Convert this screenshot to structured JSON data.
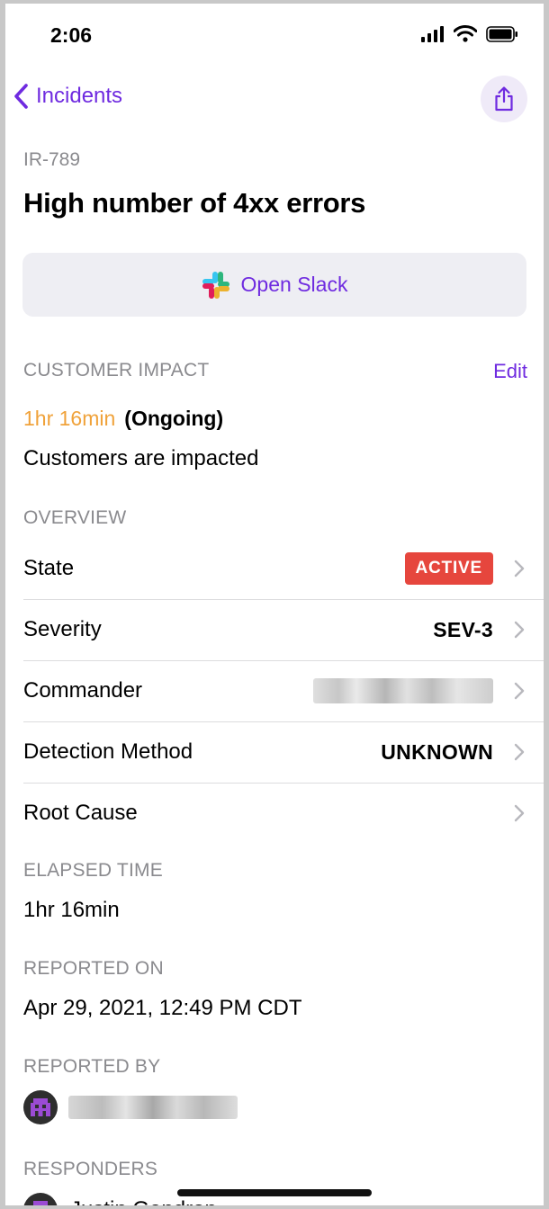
{
  "status_bar": {
    "time": "2:06"
  },
  "nav": {
    "back_label": "Incidents"
  },
  "incident": {
    "id": "IR-789",
    "title": "High number of 4xx errors"
  },
  "slack": {
    "label": "Open Slack"
  },
  "customer_impact": {
    "section_label": "CUSTOMER IMPACT",
    "edit_label": "Edit",
    "duration": "1hr 16min",
    "status": "(Ongoing)",
    "description": "Customers are impacted"
  },
  "overview": {
    "section_label": "OVERVIEW",
    "rows": [
      {
        "label": "State",
        "value": "ACTIVE"
      },
      {
        "label": "Severity",
        "value": "SEV-3"
      },
      {
        "label": "Commander",
        "value": ""
      },
      {
        "label": "Detection Method",
        "value": "UNKNOWN"
      },
      {
        "label": "Root Cause",
        "value": ""
      }
    ]
  },
  "elapsed": {
    "section_label": "ELAPSED TIME",
    "value": "1hr 16min"
  },
  "reported_on": {
    "section_label": "REPORTED ON",
    "value": "Apr 29, 2021, 12:49 PM CDT"
  },
  "reported_by": {
    "section_label": "REPORTED BY"
  },
  "responders": {
    "section_label": "RESPONDERS",
    "first_name": "Justin Gendron"
  },
  "colors": {
    "accent": "#6f2be0",
    "active_badge": "#e6463d",
    "duration": "#f0a23a"
  }
}
